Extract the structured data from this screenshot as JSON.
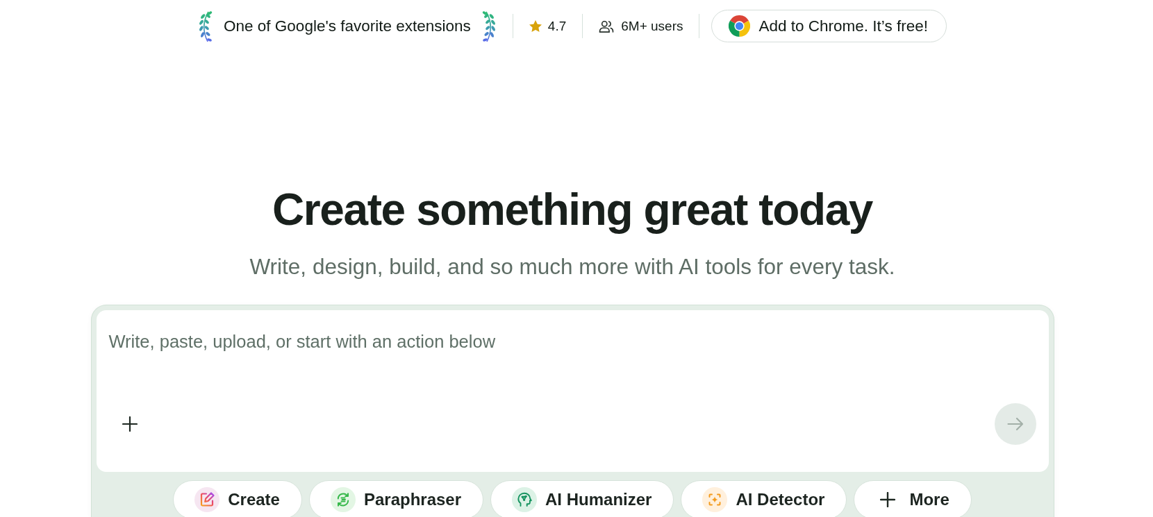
{
  "top_bar": {
    "award": "One of Google's favorite extensions",
    "rating": "4.7",
    "users": "6M+ users",
    "cta": "Add to Chrome. It’s free!"
  },
  "hero": {
    "title": "Create something great today",
    "subtitle": "Write, design, build, and so much more with AI tools for every task."
  },
  "composer": {
    "placeholder": "Write, paste, upload, or start with an action below",
    "send_button": {
      "disabled": true
    }
  },
  "actions": [
    {
      "kind": "create",
      "label": "Create"
    },
    {
      "kind": "paraphrase",
      "label": "Paraphraser"
    },
    {
      "kind": "humanize",
      "label": "AI Humanizer"
    },
    {
      "kind": "detect",
      "label": "AI Detector"
    },
    {
      "kind": "more",
      "label": "More"
    }
  ]
}
